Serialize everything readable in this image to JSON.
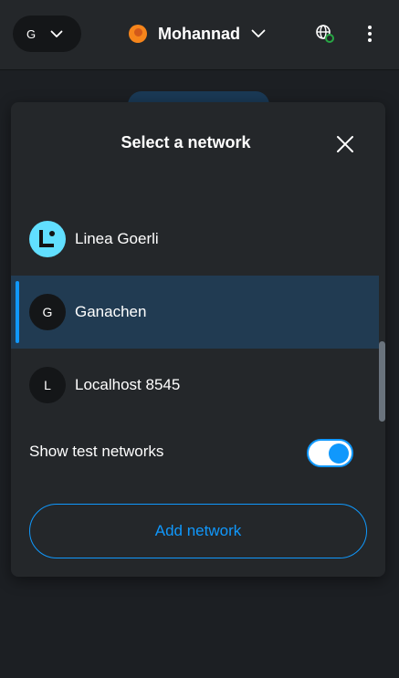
{
  "header": {
    "network_letter": "G",
    "account_name": "Mohannad"
  },
  "modal": {
    "title": "Select a network",
    "networks": [
      {
        "label": "Linea Goerli",
        "avatar": "",
        "selected": false
      },
      {
        "label": "Ganachen",
        "avatar": "G",
        "selected": true
      },
      {
        "label": "Localhost 8545",
        "avatar": "L",
        "selected": false
      }
    ],
    "toggle_label": "Show test networks",
    "toggle_on": true,
    "add_button_label": "Add network"
  },
  "colors": {
    "accent": "#1098fc",
    "selected_row": "#213b52",
    "linea": "#61dfff",
    "fox": "#f6851b",
    "modal_bg": "#24272a"
  },
  "icons": [
    "chevron-down-icon",
    "metamask-fox-icon",
    "globe-connected-icon",
    "kebab-menu-icon",
    "close-icon",
    "linea-logo-icon"
  ]
}
